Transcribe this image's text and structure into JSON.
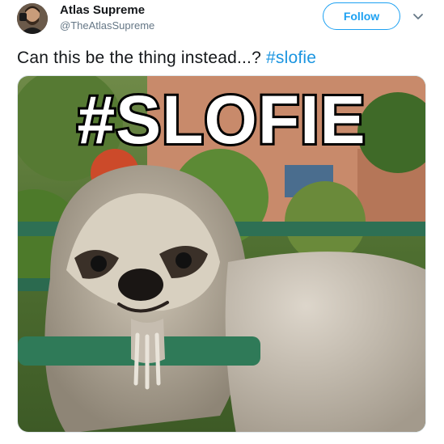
{
  "tweet": {
    "author": {
      "display_name": "Atlas Supreme",
      "handle": "@TheAtlasSupreme",
      "avatar_icon": "avatar-photo"
    },
    "follow_label": "Follow",
    "menu_icon": "chevron-down-icon",
    "text_prefix": "Can this be the thing instead...? ",
    "hashtag": "#slofie",
    "media": {
      "caption_overlay": "#SLOFIE",
      "subject": "sloth-selfie-photo"
    }
  },
  "colors": {
    "accent": "#1da1f2",
    "hashtag": "#1b95e0",
    "text": "#14171a",
    "muted": "#657786"
  }
}
